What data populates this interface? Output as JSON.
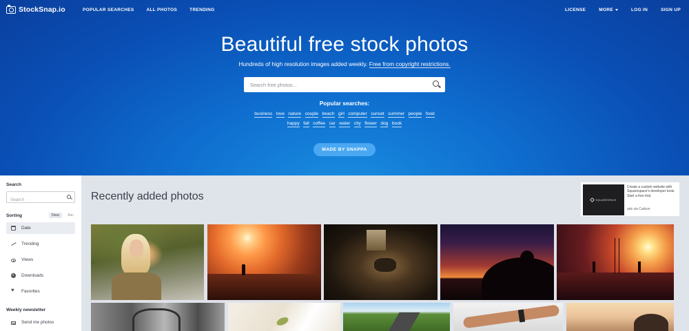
{
  "header": {
    "logo_text": "StockSnap.io",
    "nav_left": [
      "POPULAR SEARCHES",
      "ALL PHOTOS",
      "TRENDING"
    ],
    "nav_right": [
      "LICENSE",
      "MORE",
      "LOG IN",
      "SIGN UP"
    ]
  },
  "hero": {
    "title": "Beautiful free stock photos",
    "subtitle_prefix": "Hundreds of high resolution images added weekly.",
    "subtitle_link": "Free from copyright restrictions.",
    "search_placeholder": "Search free photos...",
    "popular_heading": "Popular searches:",
    "tags_row1": [
      "business",
      "love",
      "nature",
      "couple",
      "beach",
      "girl",
      "computer",
      "sunset",
      "summer",
      "people",
      "food"
    ],
    "tags_row2": [
      "happy",
      "fall",
      "coffee",
      "car",
      "water",
      "city",
      "flower",
      "dog",
      "book"
    ],
    "cta_label": "MADE BY SNAPPA"
  },
  "sidebar": {
    "search_heading": "Search",
    "search_placeholder": "Search",
    "sorting_heading": "Sorting",
    "sort_desc": "Desc",
    "sort_asc": "Asc",
    "sort_items": [
      {
        "label": "Date",
        "icon": "calendar-icon",
        "active": true
      },
      {
        "label": "Trending",
        "icon": "trending-icon",
        "active": false
      },
      {
        "label": "Views",
        "icon": "eye-icon",
        "active": false
      },
      {
        "label": "Downloads",
        "icon": "download-icon",
        "active": false
      },
      {
        "label": "Favorites",
        "icon": "heart-icon",
        "active": false
      }
    ],
    "newsletter_heading": "Weekly newsletter",
    "newsletter_item": "Send me photos"
  },
  "main": {
    "title": "Recently added photos",
    "ad": {
      "brand": "SQUARESPACE",
      "text": "Create a custom website with Squarespace's developer tools. Start a free trial.",
      "via": "ads via Carbon"
    }
  },
  "colors": {
    "hero_blue": "#0a4fb5",
    "cta_blue": "#4aa8f2",
    "page_bg": "#dfe3ea"
  }
}
